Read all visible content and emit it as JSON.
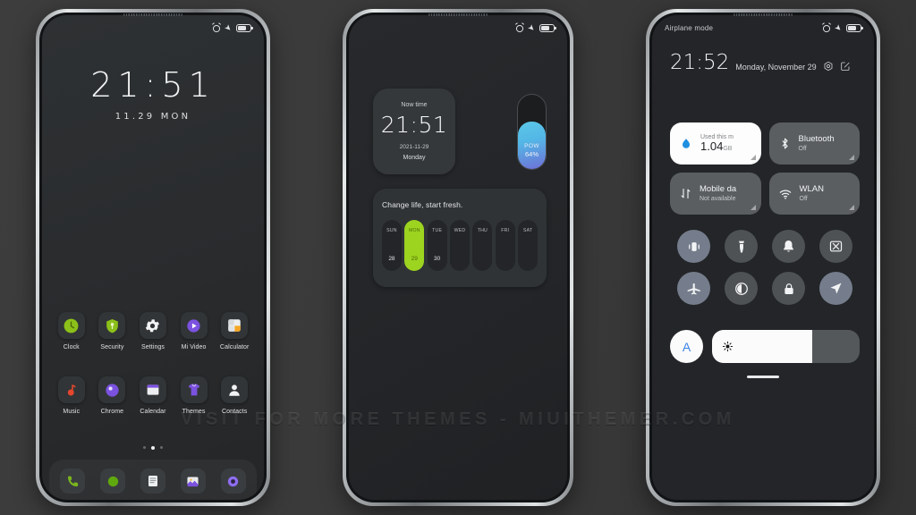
{
  "watermark": "VISIT FOR MORE THEMES - MIUITHEMER.COM",
  "statusbar": {
    "alarm_icon": "alarm-clock-icon",
    "airplane_icon": "airplane-icon",
    "battery_icon": "battery-icon"
  },
  "phone1": {
    "clock": "21:51",
    "date": "11.29  MON",
    "apps_row1": [
      {
        "label": "Clock",
        "icon": "clock-app-icon"
      },
      {
        "label": "Security",
        "icon": "security-shield-icon"
      },
      {
        "label": "Settings",
        "icon": "gear-icon"
      },
      {
        "label": "Mi Video",
        "icon": "video-play-icon"
      },
      {
        "label": "Calculator",
        "icon": "calculator-icon"
      }
    ],
    "apps_row2": [
      {
        "label": "Music",
        "icon": "music-note-icon"
      },
      {
        "label": "Chrome",
        "icon": "chrome-browser-icon"
      },
      {
        "label": "Calendar",
        "icon": "calendar-icon"
      },
      {
        "label": "Themes",
        "icon": "themes-shirt-icon"
      },
      {
        "label": "Contacts",
        "icon": "contacts-person-icon"
      }
    ],
    "dock": [
      {
        "icon": "phone-handset-icon"
      },
      {
        "icon": "messages-icon"
      },
      {
        "icon": "notes-icon"
      },
      {
        "icon": "gallery-image-icon"
      },
      {
        "icon": "browser-icon"
      }
    ],
    "page_dots": {
      "count": 3,
      "active_index": 1
    }
  },
  "phone2": {
    "clock_widget": {
      "label": "Now time",
      "time": "21:51",
      "date": "2021-11-29",
      "weekday": "Monday"
    },
    "battery_widget": {
      "label": "POW",
      "percent_label": "64%",
      "percent": 64,
      "gradient_from": "#5cc8e8",
      "gradient_to": "#6f6fd6"
    },
    "calendar_widget": {
      "quote": "Change life, start fresh.",
      "accent": "#9cd420",
      "days": [
        {
          "name": "SUN",
          "date": "28",
          "active": false
        },
        {
          "name": "MON",
          "date": "29",
          "active": true
        },
        {
          "name": "TUE",
          "date": "30",
          "active": false
        },
        {
          "name": "WED",
          "date": "",
          "active": false
        },
        {
          "name": "THU",
          "date": "",
          "active": false
        },
        {
          "name": "FRI",
          "date": "",
          "active": false
        },
        {
          "name": "SAT",
          "date": "",
          "active": false
        }
      ]
    }
  },
  "phone3": {
    "status_label": "Airplane mode",
    "time": "21:52",
    "date": "Monday, November 29",
    "settings_icon": "gear-icon",
    "edit_icon": "edit-pencil-icon",
    "tiles": [
      {
        "style": "light",
        "icon": "data-drop-icon",
        "top": "Used this m",
        "title": "1.04",
        "unit": "GB",
        "sub": ""
      },
      {
        "style": "dark",
        "icon": "bluetooth-icon",
        "title": "Bluetooth",
        "sub": "Off"
      },
      {
        "style": "dark",
        "icon": "mobile-data-icon",
        "title": "Mobile da",
        "sub": "Not available"
      },
      {
        "style": "dark",
        "icon": "wlan-wifi-icon",
        "title": "WLAN",
        "sub": "Off"
      }
    ],
    "toggles": [
      {
        "icon": "vibrate-icon",
        "on": true
      },
      {
        "icon": "flashlight-icon",
        "on": false
      },
      {
        "icon": "bell-icon",
        "on": false
      },
      {
        "icon": "screenshot-icon",
        "on": false
      },
      {
        "icon": "airplane-mode-icon",
        "on": true
      },
      {
        "icon": "dark-mode-icon",
        "on": false
      },
      {
        "icon": "lock-icon",
        "on": false
      },
      {
        "icon": "location-icon",
        "on": true
      }
    ],
    "brightness": {
      "auto_label": "A",
      "slider_icon": "sun-brightness-icon",
      "level": 68
    }
  }
}
